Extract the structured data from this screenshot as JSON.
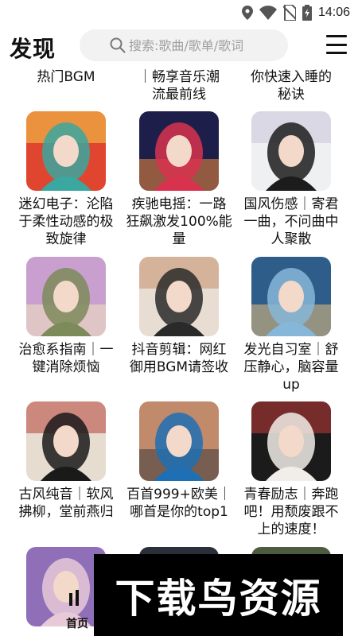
{
  "status_bar": {
    "time": "14:06",
    "icons": [
      "location-icon",
      "wifi-icon",
      "no-sim-icon",
      "battery-icon"
    ]
  },
  "header": {
    "title": "发现",
    "search_placeholder": "搜索:歌曲/歌单/歌词",
    "menu_icon": "menu-icon"
  },
  "top_row_captions": [
    "热门BGM",
    "｜畅享音乐潮流最前线",
    "你快速入睡的秘诀"
  ],
  "playlists": [
    {
      "caption": "迷幻电子：沦陷于柔性动感的极致旋律",
      "cover_colors": [
        "#e0452f",
        "#3aa7a0",
        "#f4d24a"
      ]
    },
    {
      "caption": "疾驰电摇：一路狂飙激发100%能量",
      "cover_colors": [
        "#1d1f4a",
        "#d8324e",
        "#f48b3c"
      ]
    },
    {
      "caption": "国风伤感｜寄君一曲，不问曲中人聚散",
      "cover_colors": [
        "#eef0f2",
        "#1c1c1c",
        "#c9c5d8"
      ]
    },
    {
      "caption": "治愈系指南｜一键消除烦恼",
      "cover_colors": [
        "#c99fcf",
        "#7d8a5a",
        "#f3e3c1"
      ]
    },
    {
      "caption": "抖音剪辑：网红御用BGM请签收",
      "cover_colors": [
        "#e7ddd2",
        "#2a2a2a",
        "#c58f6b"
      ]
    },
    {
      "caption": "发光自习室｜舒压静心，脑容量up",
      "cover_colors": [
        "#2f5d8a",
        "#86b7d9",
        "#e7c07a"
      ]
    },
    {
      "caption": "古风纯音｜软风拂柳，堂前燕归",
      "cover_colors": [
        "#e6dccf",
        "#1a1a1a",
        "#b8433a"
      ]
    },
    {
      "caption": "百首999+欧美｜哪首是你的top1",
      "cover_colors": [
        "#c08a6b",
        "#1f6fb4",
        "#3a3a3a"
      ]
    },
    {
      "caption": "青春励志｜奔跑吧！用颓废跟不上的速度！",
      "cover_colors": [
        "#1b1b1b",
        "#f1ede8",
        "#c23b3b"
      ]
    }
  ],
  "partial_covers": [
    {
      "cover_colors": [
        "#8e6fb8",
        "#e8c9d8"
      ]
    },
    {
      "cover_colors": [
        "#2a2f3a",
        "#5a6272"
      ]
    },
    {
      "cover_colors": [
        "#4d5b3f",
        "#9aa07a"
      ]
    }
  ],
  "bottom_nav": {
    "home_label": "首页"
  },
  "watermark": {
    "text": "下载鸟资源"
  }
}
